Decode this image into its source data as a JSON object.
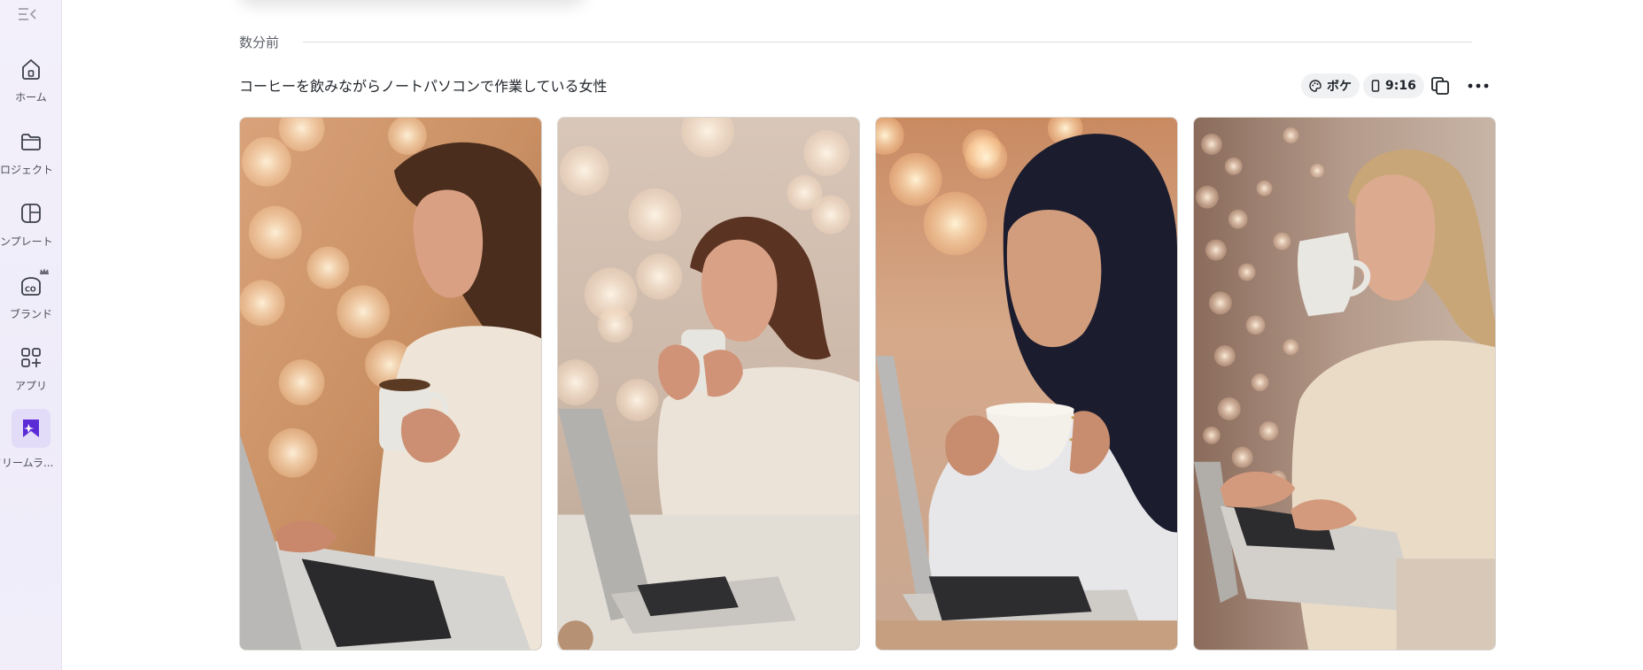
{
  "sidebar": {
    "collapse_icon": "collapse-sidebar-icon",
    "items": [
      {
        "label": "ホーム",
        "icon": "home-icon"
      },
      {
        "label": "プロジェクト",
        "icon": "folder-icon"
      },
      {
        "label": "テンプレート",
        "icon": "template-icon"
      },
      {
        "label": "ブランド",
        "icon": "brand-icon",
        "badge": "crown-icon"
      },
      {
        "label": "アプリ",
        "icon": "apps-icon"
      },
      {
        "label": "ドリームラ...",
        "icon": "dream-lab-icon",
        "active": true
      }
    ]
  },
  "history": {
    "timestamp": "数分前",
    "prompt": "コーヒーを飲みながらノートパソコンで作業している女性",
    "style_chip": {
      "label": "ボケ",
      "icon": "palette-icon"
    },
    "ratio_chip": {
      "label": "9:16",
      "icon": "phone-portrait-icon"
    },
    "actions": [
      "copy-icon",
      "more-options-icon"
    ]
  },
  "images": [
    {
      "name": "generated-image-1",
      "subject": "woman with brown hair typing on laptop holding mug"
    },
    {
      "name": "generated-image-2",
      "subject": "woman sipping coffee at laptop"
    },
    {
      "name": "generated-image-3",
      "subject": "woman in hijab holding teacup at laptop"
    },
    {
      "name": "generated-image-4",
      "subject": "blonde woman drinking from mug while typing"
    }
  ],
  "colors": {
    "sidebar_bg": "#f1eefa",
    "accent": "#7d2ae8",
    "chip_bg": "#f0f1f3"
  }
}
